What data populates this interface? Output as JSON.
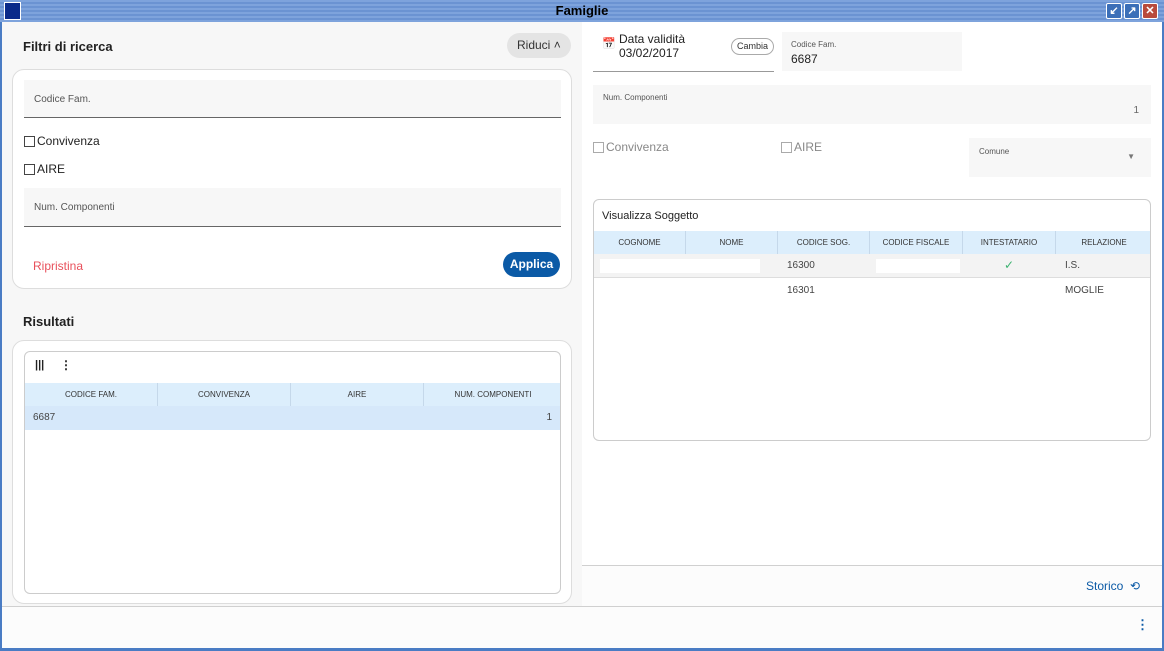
{
  "window": {
    "title": "Famiglie",
    "buttons": [
      "↙",
      "↗",
      "✕"
    ]
  },
  "filters": {
    "title": "Filtri di ricerca",
    "collapse_label": "Riduci",
    "codice_label": "Codice Fam.",
    "convivenza_label": "Convivenza",
    "aire_label": "AIRE",
    "num_label": "Num. Componenti",
    "reset_label": "Ripristina",
    "apply_label": "Applica"
  },
  "results": {
    "title": "Risultati",
    "columns": [
      "CODICE FAM.",
      "CONVIVENZA",
      "AIRE",
      "NUM. COMPONENTI"
    ],
    "rows": [
      {
        "codice": "6687",
        "convivenza": "",
        "aire": "",
        "num": "1"
      }
    ]
  },
  "detail": {
    "date_label": "Data validità",
    "date_value": "03/02/2017",
    "change_label": "Cambia",
    "codice_label": "Codice Fam.",
    "codice_value": "6687",
    "num_label": "Num. Componenti",
    "num_value": "1",
    "convivenza_label": "Convivenza",
    "aire_label": "AIRE",
    "comune_label": "Comune"
  },
  "soggetti": {
    "title": "Visualizza Soggetto",
    "columns": [
      "COGNOME",
      "NOME",
      "CODICE SOG.",
      "CODICE FISCALE",
      "INTESTATARIO",
      "RELAZIONE"
    ],
    "rows": [
      {
        "codice": "16300",
        "intestatario": true,
        "relazione": "I.S."
      },
      {
        "codice": "16301",
        "intestatario": false,
        "relazione": "MOGLIE"
      }
    ]
  },
  "footer": {
    "storico_label": "Storico"
  },
  "colors": {
    "accent": "#0b5aa6",
    "reset": "#e8505b",
    "check": "#3cb371"
  }
}
